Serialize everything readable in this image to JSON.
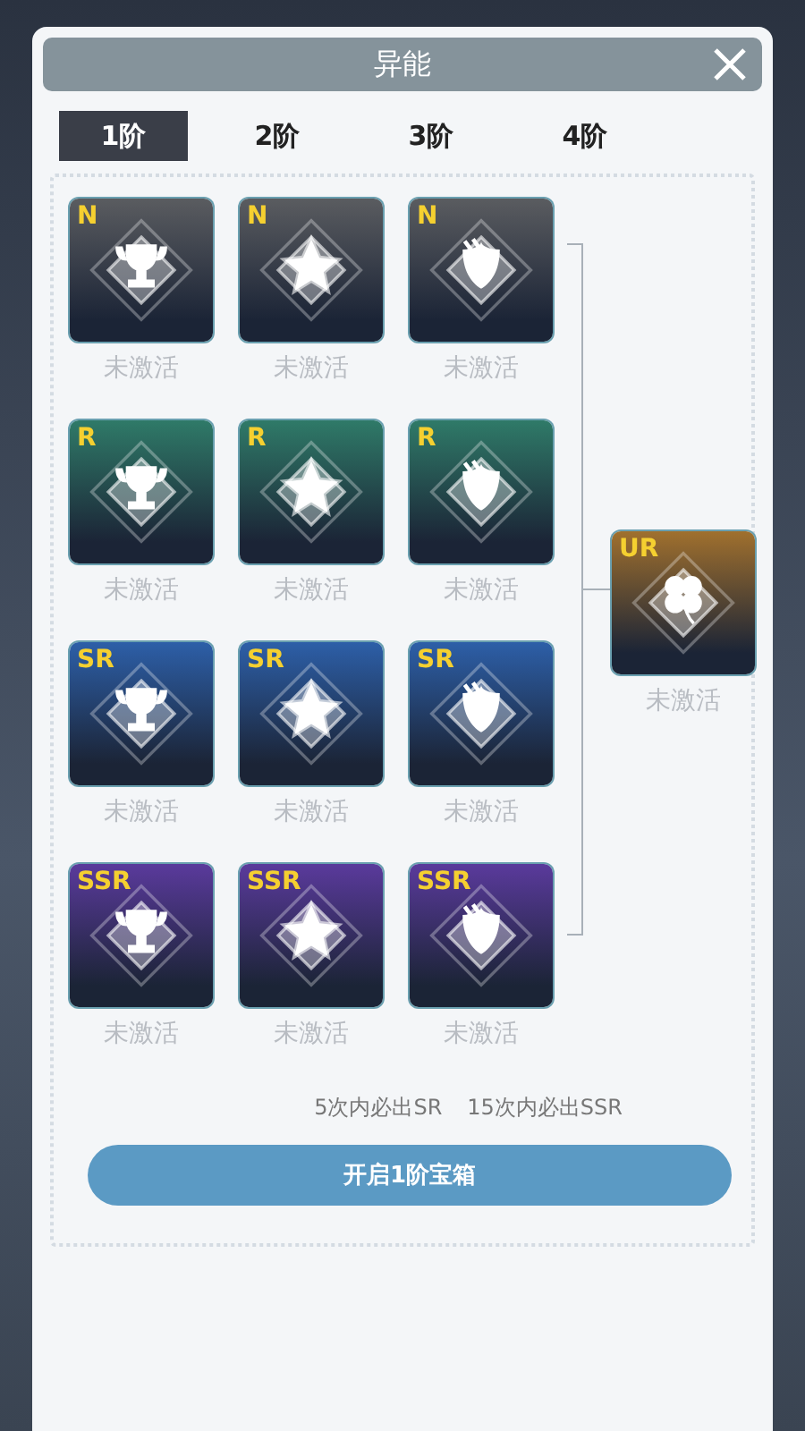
{
  "title": "异能",
  "tabs": [
    {
      "label": "1阶",
      "selected": true
    },
    {
      "label": "2阶",
      "selected": false
    },
    {
      "label": "3阶",
      "selected": false
    },
    {
      "label": "4阶",
      "selected": false
    }
  ],
  "tiers": [
    {
      "color": "#5a5c60",
      "cards": [
        {
          "kind": "trophy",
          "grade": "N",
          "status": "未激活"
        },
        {
          "kind": "star",
          "grade": "N",
          "status": "未激活"
        },
        {
          "kind": "shield",
          "grade": "N",
          "status": "未激活"
        }
      ]
    },
    {
      "color": "#2f7a68",
      "cards": [
        {
          "kind": "trophy",
          "grade": "R",
          "status": "未激活"
        },
        {
          "kind": "star",
          "grade": "R",
          "status": "未激活"
        },
        {
          "kind": "shield",
          "grade": "R",
          "status": "未激活"
        }
      ]
    },
    {
      "color": "#2d5fa8",
      "cards": [
        {
          "kind": "trophy",
          "grade": "SR",
          "status": "未激活"
        },
        {
          "kind": "star",
          "grade": "SR",
          "status": "未激活"
        },
        {
          "kind": "shield",
          "grade": "SR",
          "status": "未激活"
        }
      ]
    },
    {
      "color": "#5a3a9c",
      "cards": [
        {
          "kind": "trophy",
          "grade": "SSR",
          "status": "未激活"
        },
        {
          "kind": "star",
          "grade": "SSR",
          "status": "未激活"
        },
        {
          "kind": "shield",
          "grade": "SSR",
          "status": "未激活"
        }
      ]
    }
  ],
  "top_card": {
    "grade": "UR",
    "color": "#a0702e",
    "kind": "clover",
    "status": "未激活"
  },
  "hints": [
    "5次内必出SR",
    "15次内必出SSR"
  ],
  "open_button": "开启1阶宝箱"
}
